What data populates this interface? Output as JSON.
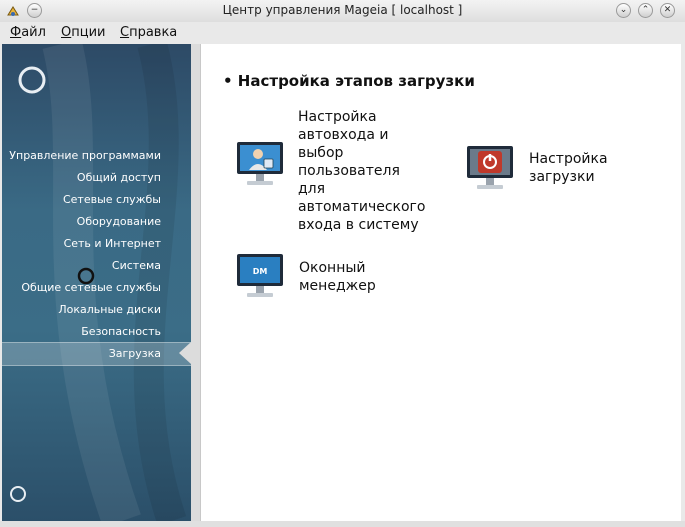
{
  "window": {
    "title": "Центр управления Mageia  [ localhost ]",
    "title_buttons": [
      "minimize-button",
      "maximize-button",
      "close-button"
    ]
  },
  "menubar": {
    "items": [
      {
        "accel": "Ф",
        "rest": "айл"
      },
      {
        "accel": "О",
        "rest": "пции"
      },
      {
        "accel": "С",
        "rest": "правка"
      }
    ]
  },
  "sidebar": {
    "items": [
      "Управление программами",
      "Общий доступ",
      "Сетевые службы",
      "Оборудование",
      "Сеть и Интернет",
      "Система",
      "Общие сетевые службы",
      "Локальные диски",
      "Безопасность",
      "Загрузка"
    ],
    "selected": "Загрузка"
  },
  "content": {
    "section_title": "• Настройка этапов загрузки",
    "tiles": [
      {
        "label": "Настройка\nавтовхода и\nвыбор\nпользователя\nдля\nавтоматического\nвхода в систему",
        "icon": "user-login-monitor-icon"
      },
      {
        "label": "Настройка\nзагрузки",
        "icon": "power-monitor-icon"
      },
      {
        "label": "Оконный\nменеджер",
        "icon": "dm-monitor-icon",
        "icon_text": "DM"
      }
    ]
  },
  "colors": {
    "sidebar_dark": "#2d4a66",
    "sidebar_light": "#3b6d87",
    "power_red": "#c0392b",
    "monitor_blue": "#2a7fc1"
  }
}
